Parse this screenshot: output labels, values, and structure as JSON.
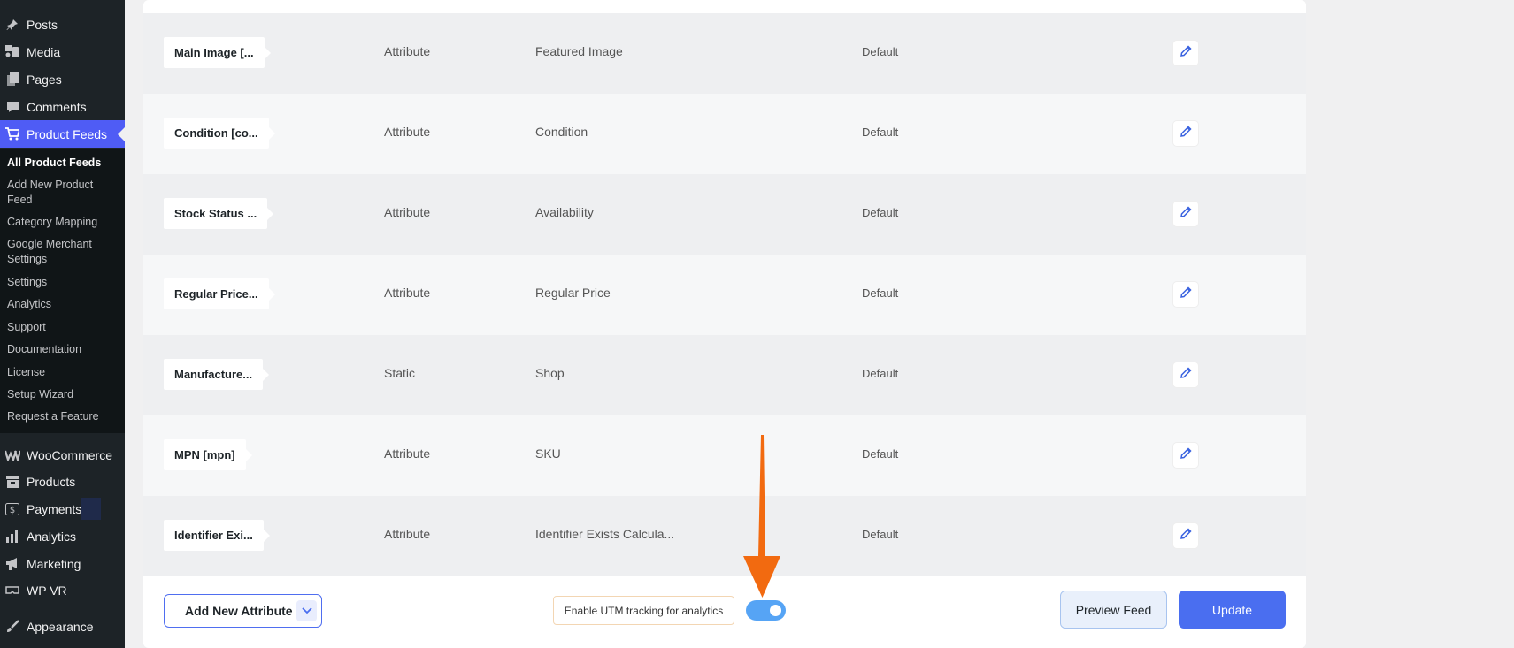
{
  "sidebar": {
    "menu": [
      {
        "label": "Posts",
        "icon": "pin-icon"
      },
      {
        "label": "Media",
        "icon": "media-icon"
      },
      {
        "label": "Pages",
        "icon": "pages-icon"
      },
      {
        "label": "Comments",
        "icon": "comment-icon"
      },
      {
        "label": "Product Feeds",
        "icon": "cart-icon"
      }
    ],
    "submenu": [
      "All Product Feeds",
      "Add New Product Feed",
      "Category Mapping",
      "Google Merchant Settings",
      "Settings",
      "Analytics",
      "Support",
      "Documentation",
      "License",
      "Setup Wizard",
      "Request a Feature"
    ],
    "lower_menu": [
      {
        "label": "WooCommerce",
        "icon": "woo-icon"
      },
      {
        "label": "Products",
        "icon": "box-icon"
      },
      {
        "label": "Payments",
        "icon": "dollar-icon"
      },
      {
        "label": "Analytics",
        "icon": "bar-chart-icon"
      },
      {
        "label": "Marketing",
        "icon": "megaphone-icon"
      },
      {
        "label": "WP VR",
        "icon": "vr-icon"
      },
      {
        "label": "Appearance",
        "icon": "brush-icon"
      }
    ]
  },
  "rows": [
    {
      "attribute": "Main Image [...",
      "type": "Attribute",
      "value": "Featured Image",
      "mode": "Default"
    },
    {
      "attribute": "Condition [co...",
      "type": "Attribute",
      "value": "Condition",
      "mode": "Default"
    },
    {
      "attribute": "Stock Status ...",
      "type": "Attribute",
      "value": "Availability",
      "mode": "Default"
    },
    {
      "attribute": "Regular Price...",
      "type": "Attribute",
      "value": "Regular Price",
      "mode": "Default"
    },
    {
      "attribute": "Manufacture...",
      "type": "Static",
      "value": "Shop",
      "mode": "Default"
    },
    {
      "attribute": "MPN [mpn]",
      "type": "Attribute",
      "value": "SKU",
      "mode": "Default"
    },
    {
      "attribute": "Identifier Exi...",
      "type": "Attribute",
      "value": "Identifier Exists Calcula...",
      "mode": "Default"
    }
  ],
  "footer": {
    "add_attribute": "Add New Attribute",
    "utm_label": "Enable UTM tracking for analytics",
    "utm_enabled": true,
    "preview": "Preview Feed",
    "update": "Update"
  },
  "colors": {
    "accent": "#4a6ef0",
    "toggle_on": "#56a4f5",
    "annotation_arrow": "#f26a10"
  }
}
